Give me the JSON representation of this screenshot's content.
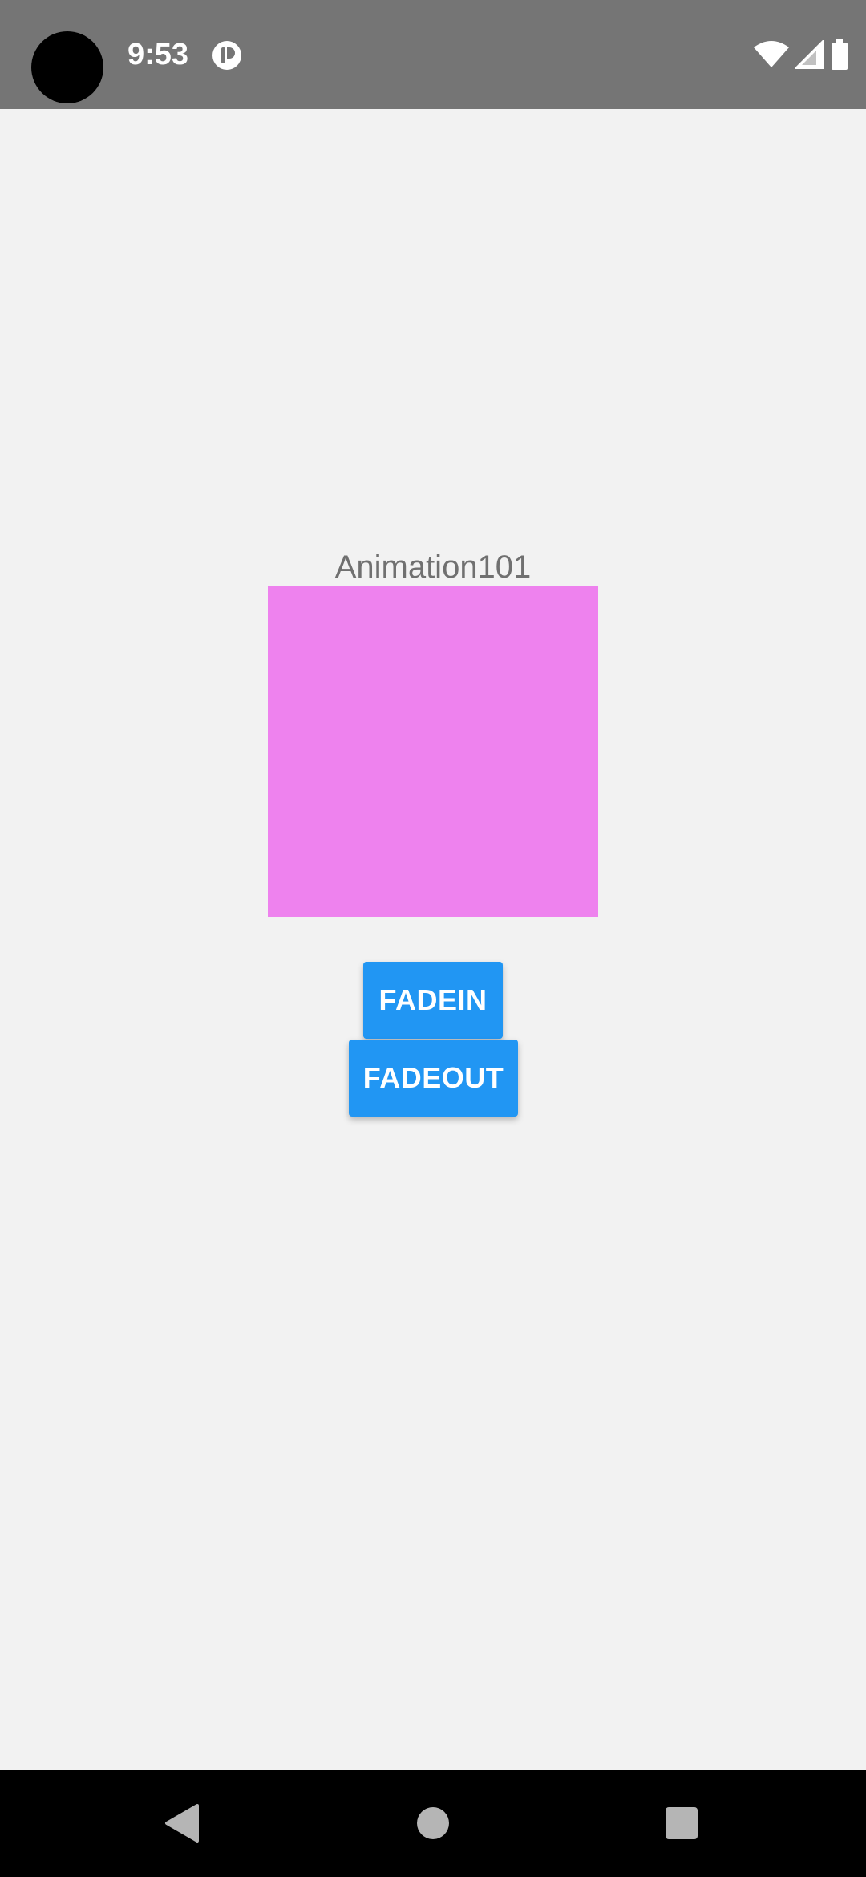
{
  "status_bar": {
    "time": "9:53",
    "icons": [
      "notification-icon",
      "wifi-icon",
      "cell-signal-icon",
      "battery-icon"
    ],
    "background": "#757575"
  },
  "main": {
    "title": "Animation101",
    "box_color": "#ee82ee",
    "buttons": {
      "fadein_label": "FADEIN",
      "fadeout_label": "FADEOUT",
      "color": "#2196f3"
    }
  },
  "nav_bar": {
    "icons": [
      "back-icon",
      "home-icon",
      "recents-icon"
    ]
  }
}
